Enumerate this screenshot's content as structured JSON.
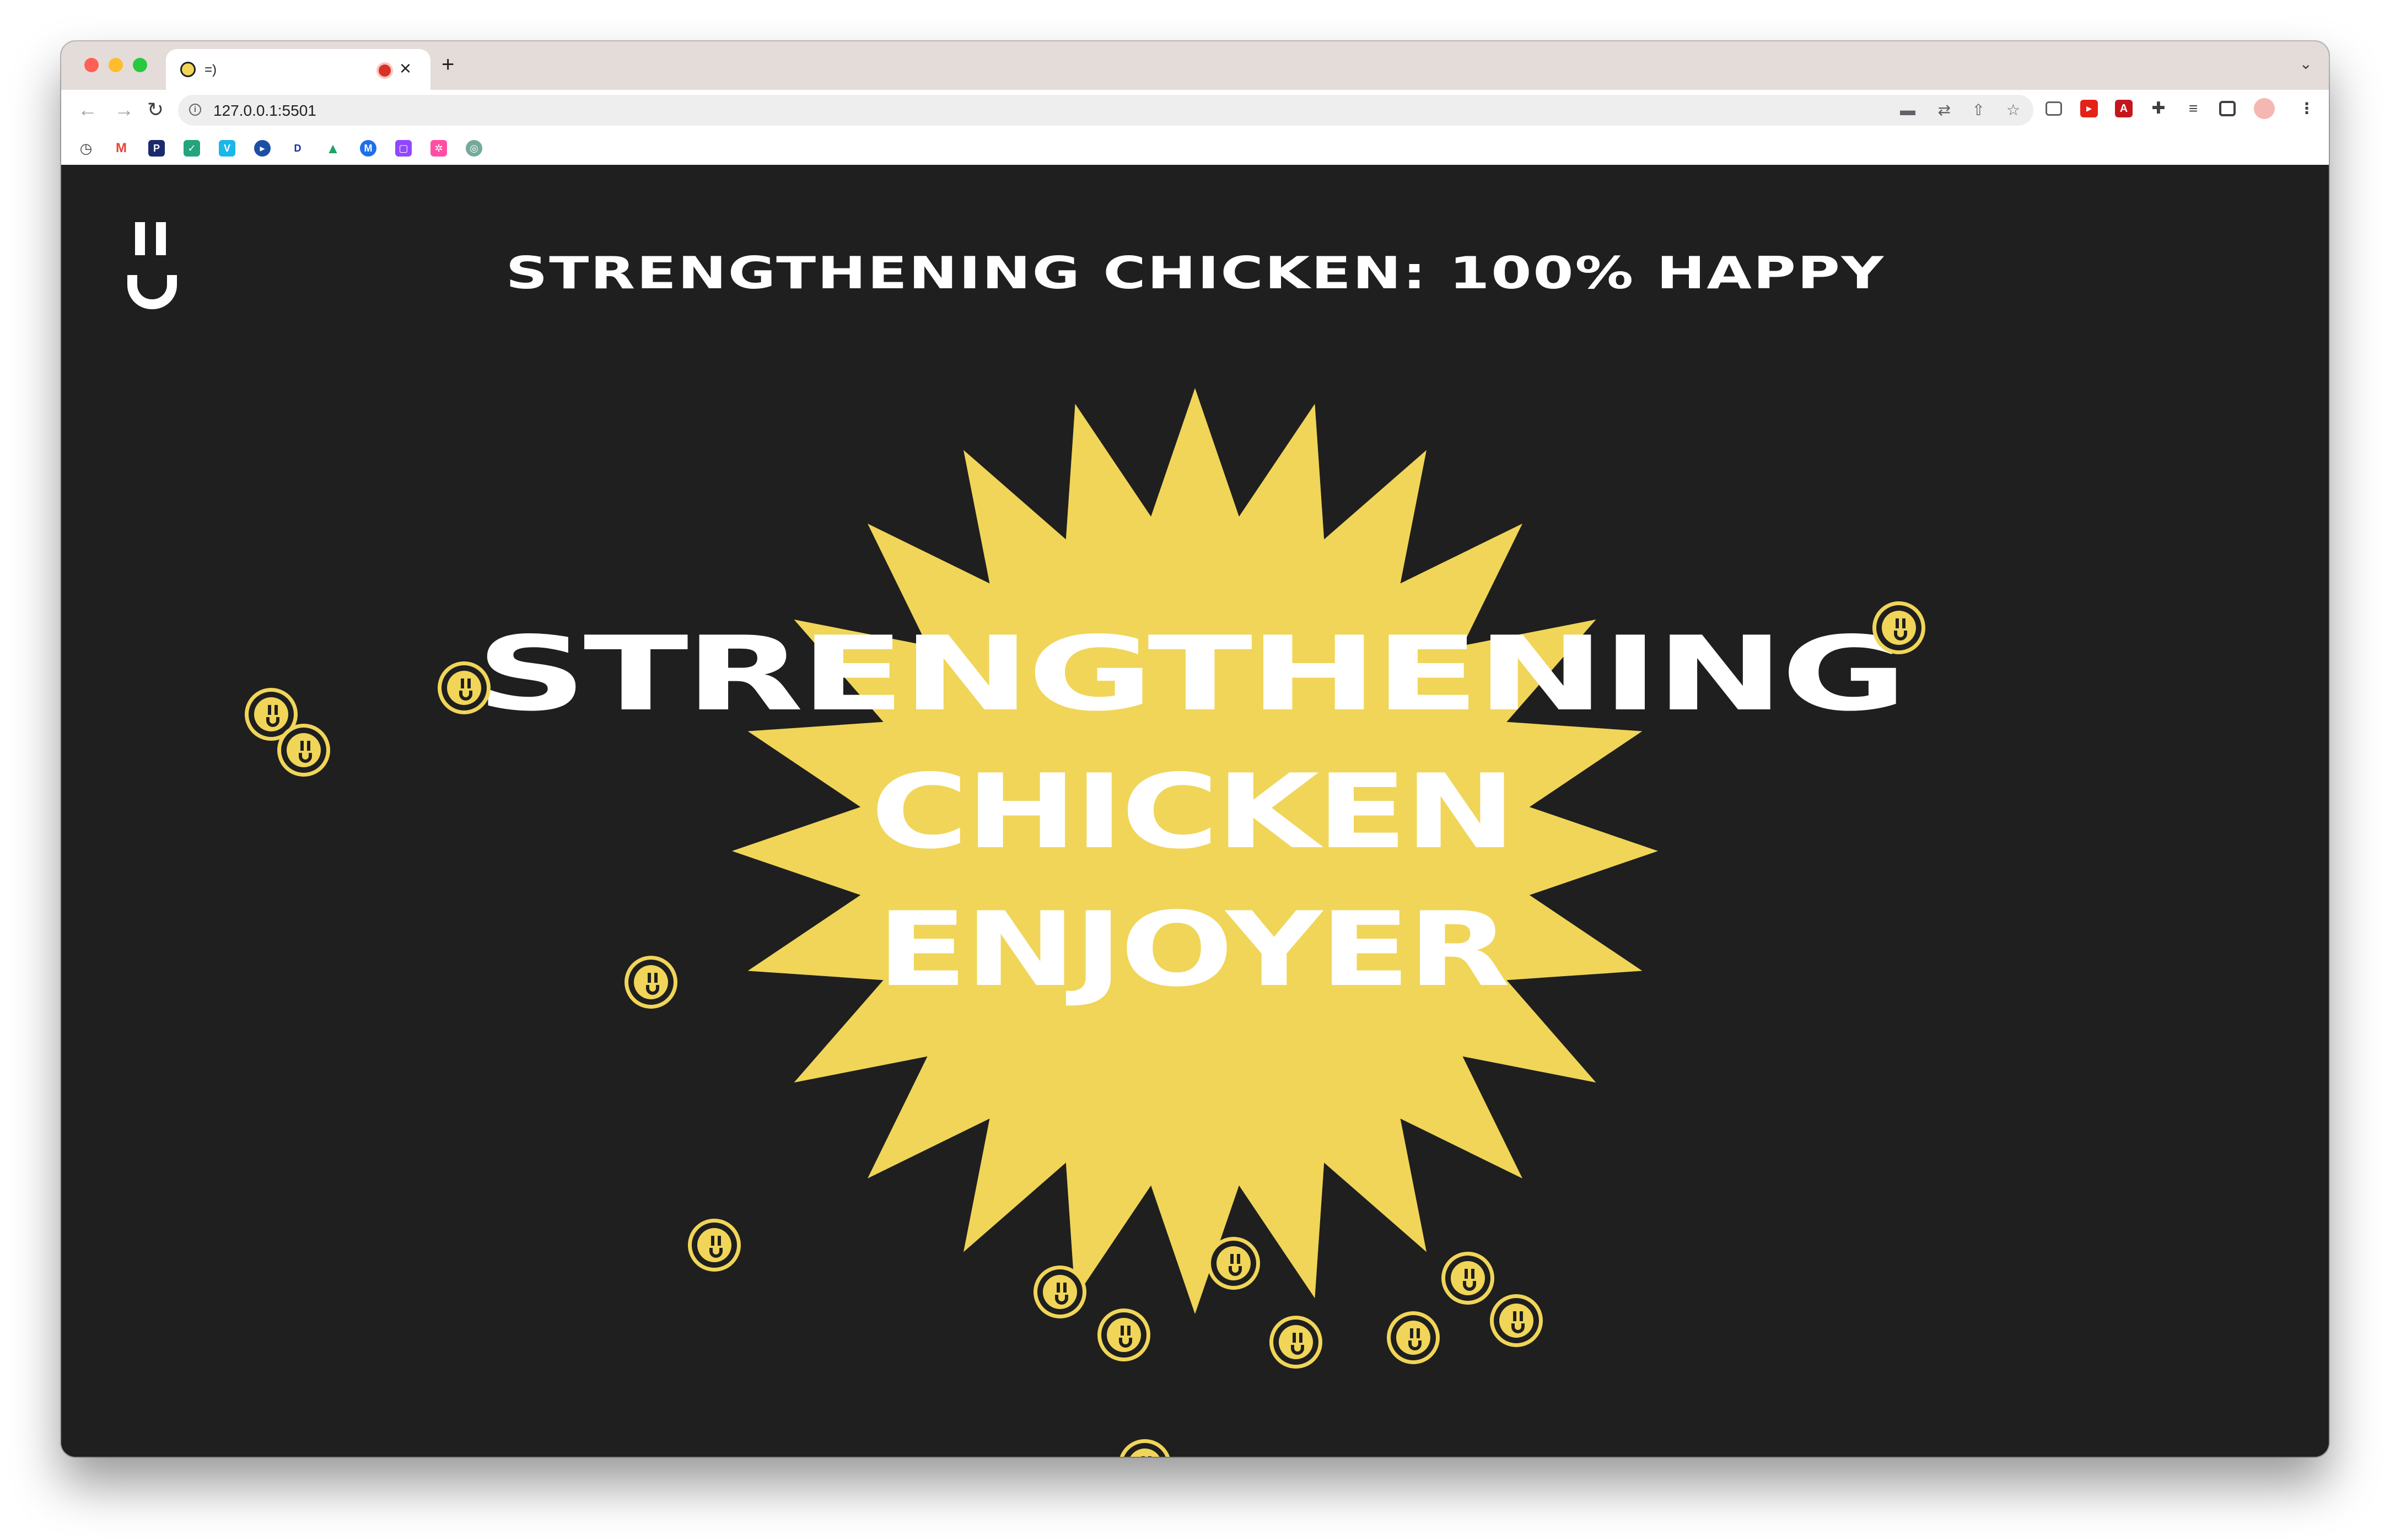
{
  "browser": {
    "tab_title": "=)",
    "tab_close": "×",
    "new_tab": "+",
    "tab_menu": "⌄",
    "nav": {
      "back": "←",
      "forward": "→",
      "reload": "↻"
    },
    "url": "127.0.0.1:5501",
    "site_info_glyph": "i",
    "omnibox_icons": [
      "camera-icon",
      "translate-icon",
      "share-icon",
      "star-icon"
    ],
    "extensions": [
      "cast-icon",
      "youtube-ext-icon",
      "pdf-ext-icon",
      "puzzle-icon",
      "playlist-icon",
      "sidepanel-icon",
      "profile-avatar",
      "more-menu-icon"
    ],
    "bookmarks": [
      "history-icon",
      "gmail-icon",
      "p-icon",
      "check-icon",
      "v-icon",
      "play-icon",
      "disney-icon",
      "drive-icon",
      "m-icon",
      "twitch-icon",
      "flower-icon",
      "chatgpt-icon"
    ]
  },
  "page": {
    "headline": "STRENGTHENING CHICKEN: 100% HAPPY",
    "hero": [
      "STRENGTHENING",
      "CHICKEN",
      "ENJOYER"
    ],
    "colors": {
      "background": "#1f1f1f",
      "accent": "#f0d558",
      "text": "#ffffff"
    }
  }
}
